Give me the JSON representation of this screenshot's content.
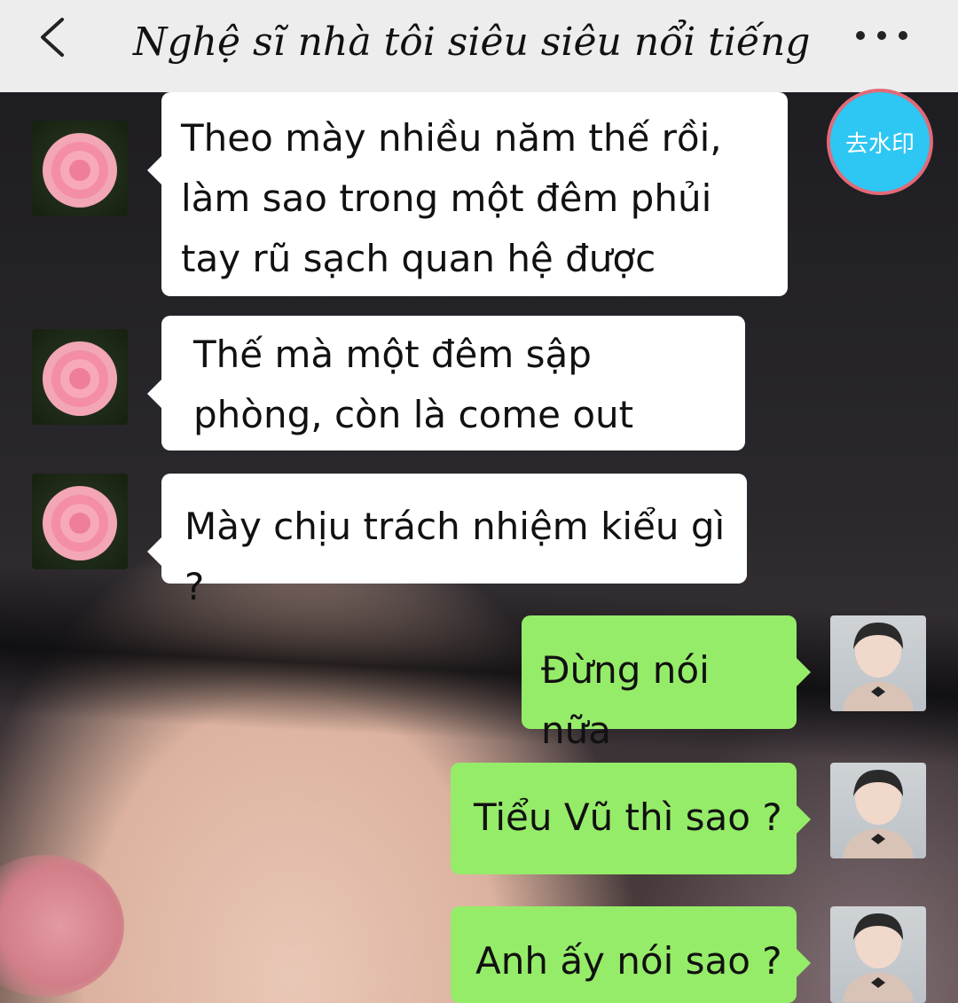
{
  "header": {
    "title": "Nghệ sĩ nhà tôi siêu siêu nổi tiếng",
    "back_icon": "chevron-left-icon",
    "more_icon": "more-dots-icon"
  },
  "watermark_button": {
    "label": "去水印"
  },
  "messages": [
    {
      "side": "left",
      "avatar": "flower-avatar",
      "text": "Theo mày nhiều năm thế rồi, làm sao trong một đêm phủi tay rũ sạch quan hệ được"
    },
    {
      "side": "left",
      "avatar": "flower-avatar",
      "text": "Thế mà một đêm sập phòng, còn là come out"
    },
    {
      "side": "left",
      "avatar": "flower-avatar",
      "text": "Mày chịu trách nhiệm kiểu gì ?"
    },
    {
      "side": "right",
      "avatar": "person-avatar",
      "text": "Đừng nói nữa"
    },
    {
      "side": "right",
      "avatar": "person-avatar",
      "text": "Tiểu Vũ thì sao ?"
    },
    {
      "side": "right",
      "avatar": "person-avatar",
      "text": "Anh ấy nói sao ?"
    }
  ],
  "colors": {
    "header_bg": "#ededed",
    "left_bubble": "#ffffff",
    "right_bubble": "#95ec69",
    "watermark_button_bg": "#2ec6f2",
    "watermark_button_border": "#e26a78"
  }
}
